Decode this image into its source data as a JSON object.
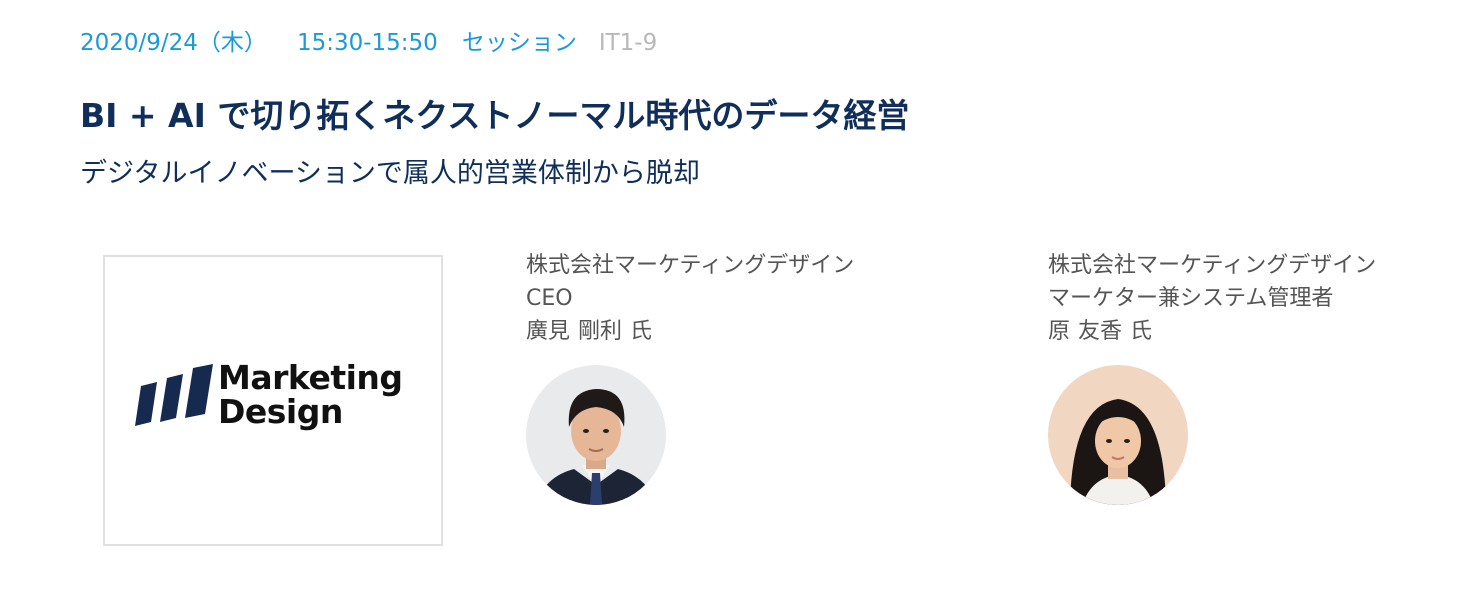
{
  "session": {
    "date": "2020/9/24（木）",
    "time": "15:30-15:50",
    "type": "セッション",
    "code": "IT1-9",
    "title": "BI + AI で切り拓くネクストノーマル時代のデータ経営",
    "subtitle": "デジタルイノベーションで属人的営業体制から脱却"
  },
  "sponsor": {
    "logo_line1": "Marketing",
    "logo_line2": "Design",
    "logo_icon": "marketing-design-bars-icon",
    "brand_color": "#162a4f"
  },
  "speakers": [
    {
      "company": "株式会社マーケティングデザイン",
      "role": "CEO",
      "family_name": "廣見",
      "given_name": "剛利",
      "honorific": "氏",
      "avatar": "man-in-suit-portrait"
    },
    {
      "company": "株式会社マーケティングデザイン",
      "role": "マーケター兼システム管理者",
      "family_name": "原",
      "given_name": "友香",
      "honorific": "氏",
      "avatar": "woman-portrait"
    }
  ],
  "colors": {
    "accent": "#1b9ad7",
    "code_gray": "#b8b8b8",
    "title_navy": "#0f2e5a",
    "speaker_text": "#555555"
  }
}
